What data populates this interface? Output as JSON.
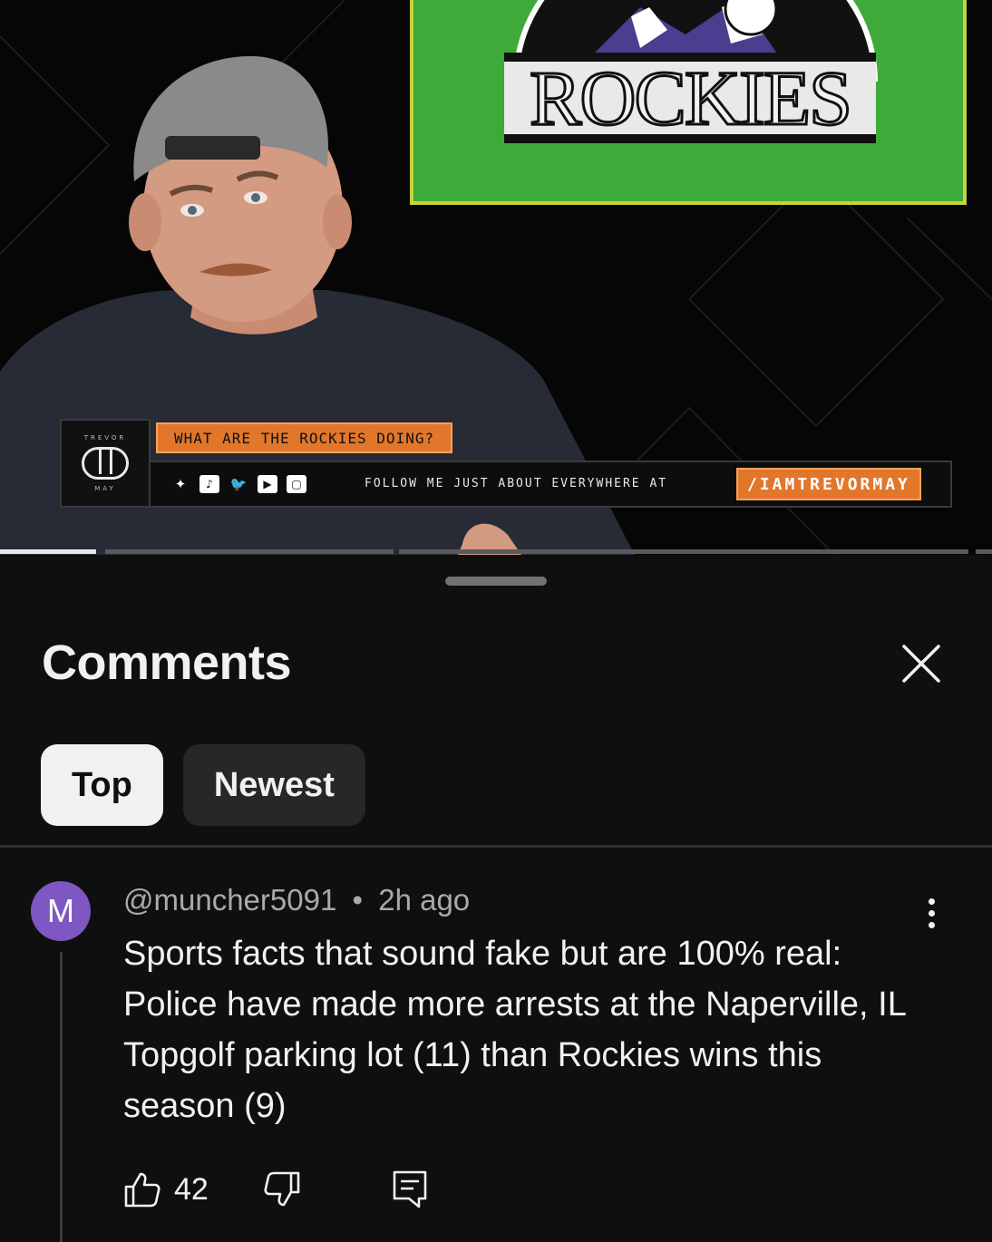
{
  "video": {
    "board_text": "ROCKIES",
    "board_letters": [
      "C",
      "O"
    ],
    "lower_third": {
      "brand_top": "TREVOR",
      "brand_bottom": "MAY",
      "title": "WHAT ARE THE ROCKIES DOING?",
      "follow_text": "FOLLOW ME JUST ABOUT EVERYWHERE AT",
      "handle": "/IAMTREVORMAY",
      "social_icons": [
        "bluesky-icon",
        "tiktok-icon",
        "twitter-icon",
        "youtube-icon",
        "twitch-icon"
      ]
    }
  },
  "comments": {
    "title": "Comments",
    "chips": [
      {
        "label": "Top",
        "selected": true
      },
      {
        "label": "Newest",
        "selected": false
      }
    ],
    "items": [
      {
        "avatar_letter": "M",
        "avatar_color": "#7e57c2",
        "author": "@muncher5091",
        "separator": "•",
        "time": "2h ago",
        "text": "Sports facts that sound fake but are 100% real: Police have made more arrests at the Naperville, IL Topgolf parking lot (11) than Rockies wins this season (9)",
        "likes": "42"
      }
    ]
  },
  "colors": {
    "background": "#0f0f0f",
    "chip_selected": "#f1f1f1",
    "chip_unselected": "#272727",
    "accent_orange": "#e2762a",
    "board_green": "#3daa3a"
  }
}
